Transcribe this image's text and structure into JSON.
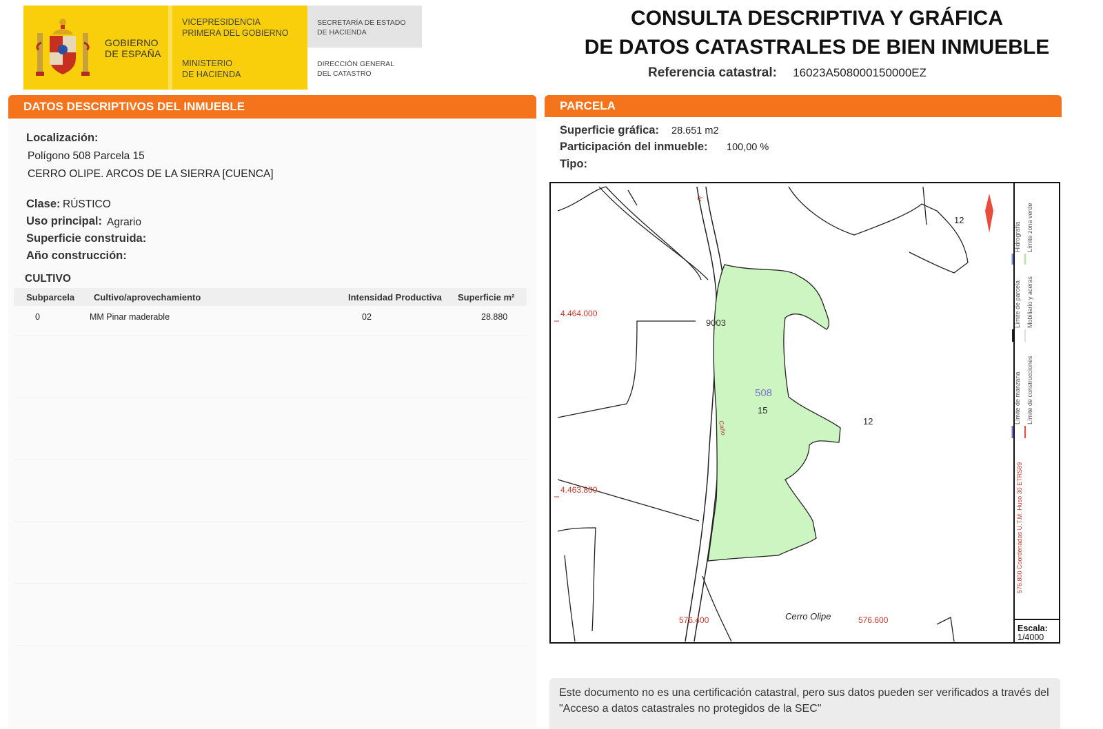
{
  "header": {
    "logo": {
      "gobierno": "GOBIERNO\nDE ESPAÑA",
      "vicepresidencia": "VICEPRESIDENCIA\nPRIMERA DEL GOBIERNO",
      "ministerio": "MINISTERIO\nDE HACIENDA",
      "secretaria": "SECRETARÍA DE ESTADO\nDE HACIENDA",
      "direccion": "DIRECCIÓN GENERAL\nDEL CATASTRO"
    },
    "title_line1": "CONSULTA DESCRIPTIVA Y GRÁFICA",
    "title_line2": "DE DATOS CATASTRALES DE BIEN INMUEBLE",
    "ref_label": "Referencia catastral:",
    "ref_value": "16023A508000150000EZ"
  },
  "descriptive": {
    "section_title": "DATOS DESCRIPTIVOS DEL INMUEBLE",
    "localizacion_label": "Localización:",
    "localizacion_line1": "Polígono 508 Parcela 15",
    "localizacion_line2": "CERRO OLIPE. ARCOS DE LA SIERRA [CUENCA]",
    "clase_label": "Clase:",
    "clase_value": "RÚSTICO",
    "uso_label": "Uso principal:",
    "uso_value": "Agrario",
    "superficie_label": "Superficie construida:",
    "anio_label": "Año construcción:",
    "cultivo_title": "CULTIVO",
    "cultivo_headers": [
      "Subparcela",
      "Cultivo/aprovechamiento",
      "Intensidad Productiva",
      "Superficie m²"
    ],
    "cultivo_rows": [
      [
        "0",
        "MM Pinar maderable",
        "02",
        "28.880"
      ]
    ]
  },
  "parcela": {
    "section_title": "PARCELA",
    "superficie_label": "Superficie gráfica:",
    "superficie_value": "28.651 m2",
    "participacion_label": "Participación del inmueble:",
    "participacion_value": "100,00 %",
    "tipo_label": "Tipo:",
    "map": {
      "parcel_color": "#cdf5c2",
      "polygon": "508",
      "parcel": "15",
      "road_code": "9003",
      "neighbor_labels": [
        "12",
        "12"
      ],
      "coord_labels": [
        "4.464.000",
        "4.463.800",
        "576.400",
        "576.600"
      ],
      "place_name": "Cerro Olipe",
      "road_small_labels": [
        "R",
        "Caño"
      ],
      "legend": {
        "items": [
          "Límite de manzana",
          "Límite de parcela",
          "Hidrografía",
          "Límite de construcciones",
          "Mobiliario y aceras",
          "Límite zona verde"
        ],
        "coords_note": "576.800 Coordenadas U.T.M. Huso 30 ETRS89"
      },
      "escala_label": "Escala:",
      "escala_value": "1/4000"
    }
  },
  "note": "Este documento no es una certificación catastral, pero sus datos pueden ser verificados a través del \"Acceso a datos catastrales no protegidos de la SEC\""
}
